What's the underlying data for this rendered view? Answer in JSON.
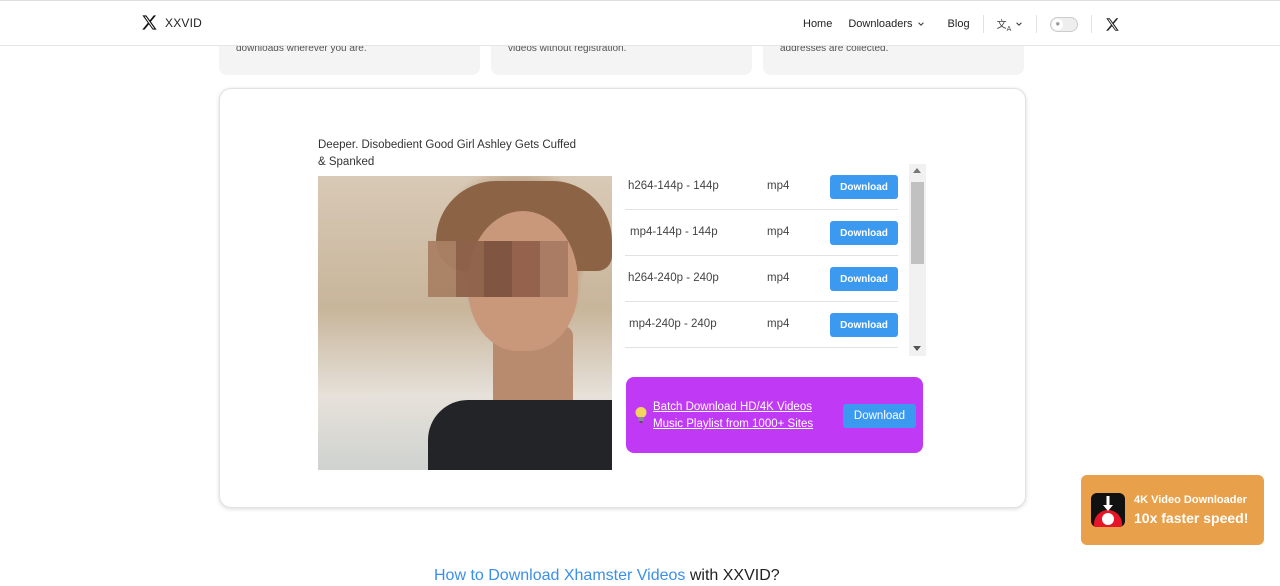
{
  "header": {
    "brand": "XXVID",
    "nav": {
      "home": "Home",
      "downloaders": "Downloaders",
      "blog": "Blog"
    },
    "icons": {
      "logo": "x-logo-icon",
      "language": "translate-icon",
      "theme_toggle": "sun-icon",
      "social": "x-twitter-icon"
    }
  },
  "features": [
    {
      "text": "downloads wherever you are."
    },
    {
      "text": "videos without registration."
    },
    {
      "text": "addresses are collected."
    }
  ],
  "video": {
    "title": "Deeper. Disobedient Good Girl Ashley Gets Cuffed & Spanked"
  },
  "formats": [
    {
      "quality": "h264-144p - 144p",
      "type": "mp4",
      "action": "Download"
    },
    {
      "quality": "mp4-144p - 144p",
      "type": "mp4",
      "action": "Download"
    },
    {
      "quality": "h264-240p - 240p",
      "type": "mp4",
      "action": "Download"
    },
    {
      "quality": "mp4-240p - 240p",
      "type": "mp4",
      "action": "Download"
    }
  ],
  "promo": {
    "line1": "Batch Download HD/4K Videos",
    "line2": "Music Playlist from 1000+ Sites",
    "button": "Download",
    "color": "#c03af5"
  },
  "float_ad": {
    "line1": "4K Video Downloader",
    "line2": "10x faster speed!",
    "color": "#e8a04a"
  },
  "how_to": {
    "accent": "How to Download Xhamster Videos",
    "rest": " with XXVID?"
  },
  "colors": {
    "accent_blue": "#3b9af0",
    "promo_purple": "#c03af5",
    "ad_orange": "#e8a04a"
  }
}
